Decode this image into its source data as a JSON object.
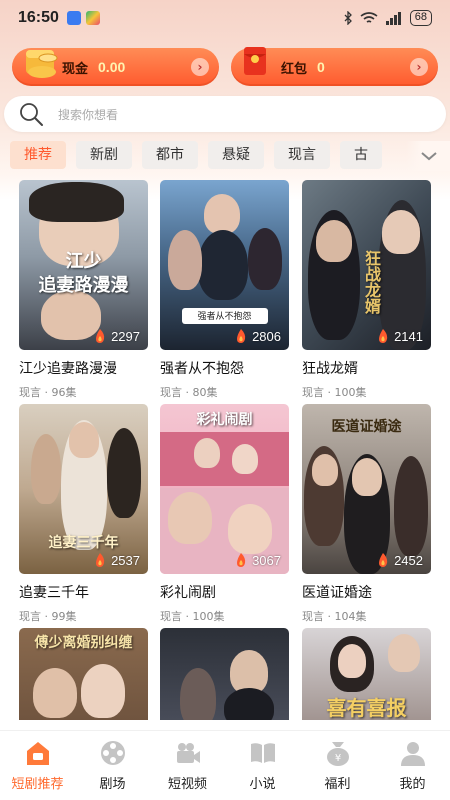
{
  "status_bar": {
    "time": "16:50",
    "battery": "68"
  },
  "wallet": {
    "cash": {
      "label": "现金",
      "value": "0.00"
    },
    "red_packet": {
      "label": "红包",
      "value": "0"
    }
  },
  "search": {
    "placeholder": "搜索你想看"
  },
  "tabs": [
    "推荐",
    "新剧",
    "都市",
    "悬疑",
    "现言",
    "古"
  ],
  "cards": [
    {
      "name": "江少追妻路漫漫",
      "meta": "现言 · 96集",
      "heat": "2297",
      "overlay": "江少\n追妻路漫漫"
    },
    {
      "name": "强者从不抱怨",
      "meta": "现言 · 80集",
      "heat": "2806",
      "overlay": "强者从不抱怨"
    },
    {
      "name": "狂战龙婿",
      "meta": "现言 · 100集",
      "heat": "2141",
      "overlay": "狂战龙婿"
    },
    {
      "name": "追妻三千年",
      "meta": "现言 · 99集",
      "heat": "2537",
      "overlay": "追妻三千年"
    },
    {
      "name": "彩礼闹剧",
      "meta": "现言 · 100集",
      "heat": "3067",
      "overlay": "彩礼闹剧"
    },
    {
      "name": "医道证婚途",
      "meta": "现言 · 104集",
      "heat": "2452",
      "overlay": "医道证婚途"
    },
    {
      "overlay": "傅少离婚别纠缠"
    },
    {
      "overlay": ""
    },
    {
      "overlay": "喜有喜报"
    }
  ],
  "bottom_nav": [
    {
      "label": "短剧推荐",
      "icon": "home-icon"
    },
    {
      "label": "剧场",
      "icon": "film-reel-icon"
    },
    {
      "label": "短视频",
      "icon": "video-camera-icon"
    },
    {
      "label": "小说",
      "icon": "book-icon"
    },
    {
      "label": "福利",
      "icon": "gift-money-icon"
    },
    {
      "label": "我的",
      "icon": "profile-icon"
    }
  ],
  "colors": {
    "accent": "#ff5a2e",
    "wallet_gradient_top": "#ff8c56",
    "active_tab_bg": "#fde0cf"
  }
}
